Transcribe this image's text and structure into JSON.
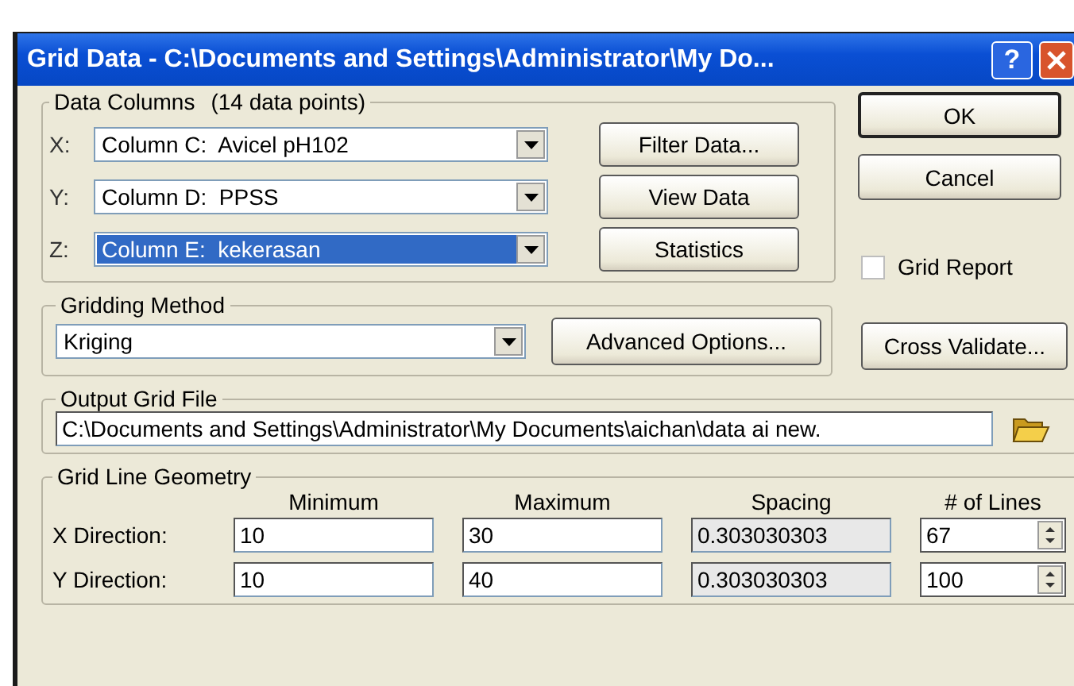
{
  "window": {
    "title": "Grid Data - C:\\Documents and Settings\\Administrator\\My Do...",
    "help_button": "?"
  },
  "data_columns": {
    "label": "Data Columns",
    "count": "(14 data points)",
    "rows": [
      {
        "axis": "X:",
        "value": "Column C:  Avicel pH102",
        "highlighted": false,
        "button": "Filter Data..."
      },
      {
        "axis": "Y:",
        "value": "Column D:  PPSS",
        "highlighted": false,
        "button": "View Data"
      },
      {
        "axis": "Z:",
        "value": "Column E:  kekerasan",
        "highlighted": true,
        "button": "Statistics"
      }
    ]
  },
  "dialog_buttons": [
    "OK",
    "Cancel"
  ],
  "grid_report": {
    "label": "Grid Report",
    "checked": false
  },
  "gridding_method": {
    "label": "Gridding Method",
    "value": "Kriging",
    "button": "Advanced Options..."
  },
  "cross_validate": "Cross Validate...",
  "output_grid_file": {
    "label": "Output Grid File",
    "path": "C:\\Documents and Settings\\Administrator\\My Documents\\aichan\\data ai new."
  },
  "grid_line_geometry": {
    "label": "Grid Line Geometry",
    "columns": [
      "Minimum",
      "Maximum",
      "Spacing",
      "# of Lines"
    ],
    "rows": [
      {
        "label": "X Direction:",
        "minimum": "10",
        "maximum": "30",
        "spacing": "0.303030303",
        "lines": "67"
      },
      {
        "label": "Y Direction:",
        "minimum": "10",
        "maximum": "40",
        "spacing": "0.303030303",
        "lines": "100"
      }
    ]
  }
}
